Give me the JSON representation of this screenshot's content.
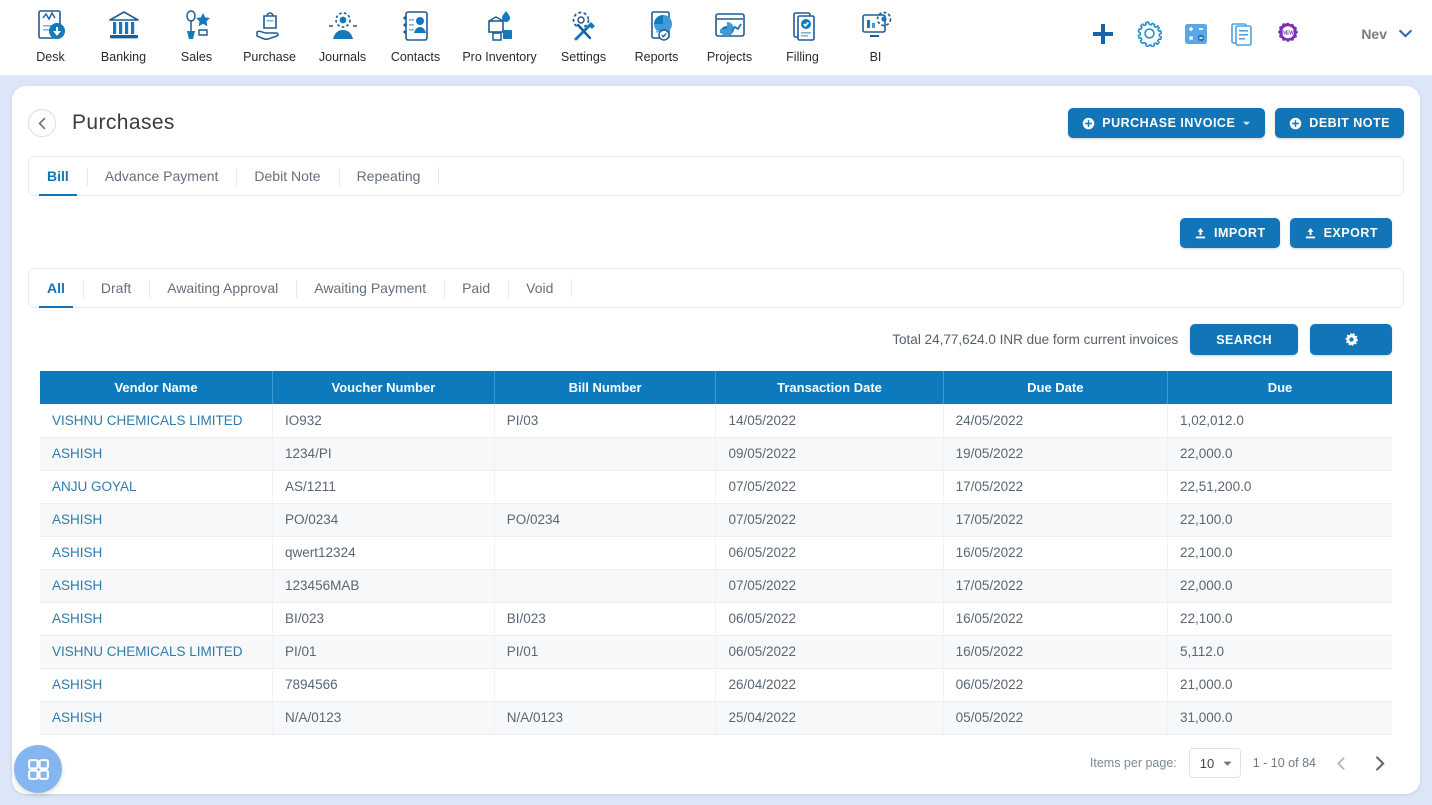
{
  "topnav": {
    "items": [
      {
        "label": "Desk",
        "icon": "desk-icon"
      },
      {
        "label": "Banking",
        "icon": "bank-icon"
      },
      {
        "label": "Sales",
        "icon": "sales-icon"
      },
      {
        "label": "Purchase",
        "icon": "purchase-icon"
      },
      {
        "label": "Journals",
        "icon": "journals-icon"
      },
      {
        "label": "Contacts",
        "icon": "contacts-icon"
      },
      {
        "label": "Pro Inventory",
        "icon": "inventory-icon"
      },
      {
        "label": "Settings",
        "icon": "settings-icon"
      },
      {
        "label": "Reports",
        "icon": "reports-icon"
      },
      {
        "label": "Projects",
        "icon": "projects-icon"
      },
      {
        "label": "Filling",
        "icon": "filling-icon"
      },
      {
        "label": "BI",
        "icon": "bi-icon"
      }
    ],
    "actions": [
      {
        "name": "add-icon",
        "title": "Add"
      },
      {
        "name": "gear-icon",
        "title": "Settings"
      },
      {
        "name": "calculator-icon",
        "title": "Calculator"
      },
      {
        "name": "document-icon",
        "title": "Documents"
      },
      {
        "name": "new-badge-icon",
        "title": "New"
      }
    ],
    "user": {
      "name": "Nev"
    }
  },
  "page": {
    "title": "Purchases",
    "back_label": "Back"
  },
  "header_buttons": {
    "purchase_invoice": "PURCHASE INVOICE",
    "debit_note": "DEBIT NOTE"
  },
  "doc_tabs": [
    {
      "label": "Bill",
      "active": true
    },
    {
      "label": "Advance Payment",
      "active": false
    },
    {
      "label": "Debit Note",
      "active": false
    },
    {
      "label": "Repeating",
      "active": false
    }
  ],
  "io_buttons": {
    "import": "IMPORT",
    "export": "EXPORT"
  },
  "status_tabs": [
    {
      "label": "All",
      "active": true
    },
    {
      "label": "Draft",
      "active": false
    },
    {
      "label": "Awaiting Approval",
      "active": false
    },
    {
      "label": "Awaiting Payment",
      "active": false
    },
    {
      "label": "Paid",
      "active": false
    },
    {
      "label": "Void",
      "active": false
    }
  ],
  "search_row": {
    "total_text": "Total 24,77,624.0 INR due form current invoices",
    "search_label": "SEARCH",
    "settings_icon": "gear-icon"
  },
  "table": {
    "columns": [
      "Vendor Name",
      "Voucher Number",
      "Bill Number",
      "Transaction Date",
      "Due Date",
      "Due"
    ],
    "rows": [
      {
        "vendor": "VISHNU CHEMICALS LIMITED",
        "voucher": "IO932",
        "bill": "PI/03",
        "txn_date": "14/05/2022",
        "due_date": "24/05/2022",
        "due": "1,02,012.0"
      },
      {
        "vendor": "ASHISH",
        "voucher": "1234/PI",
        "bill": "",
        "txn_date": "09/05/2022",
        "due_date": "19/05/2022",
        "due": "22,000.0"
      },
      {
        "vendor": "ANJU GOYAL",
        "voucher": "AS/1211",
        "bill": "",
        "txn_date": "07/05/2022",
        "due_date": "17/05/2022",
        "due": "22,51,200.0"
      },
      {
        "vendor": "ASHISH",
        "voucher": "PO/0234",
        "bill": "PO/0234",
        "txn_date": "07/05/2022",
        "due_date": "17/05/2022",
        "due": "22,100.0"
      },
      {
        "vendor": "ASHISH",
        "voucher": "qwert12324",
        "bill": "",
        "txn_date": "06/05/2022",
        "due_date": "16/05/2022",
        "due": "22,100.0"
      },
      {
        "vendor": "ASHISH",
        "voucher": "123456MAB",
        "bill": "",
        "txn_date": "07/05/2022",
        "due_date": "17/05/2022",
        "due": "22,000.0"
      },
      {
        "vendor": "ASHISH",
        "voucher": "BI/023",
        "bill": "BI/023",
        "txn_date": "06/05/2022",
        "due_date": "16/05/2022",
        "due": "22,100.0"
      },
      {
        "vendor": "VISHNU CHEMICALS LIMITED",
        "voucher": "PI/01",
        "bill": "PI/01",
        "txn_date": "06/05/2022",
        "due_date": "16/05/2022",
        "due": "5,112.0"
      },
      {
        "vendor": "ASHISH",
        "voucher": "7894566",
        "bill": "",
        "txn_date": "26/04/2022",
        "due_date": "06/05/2022",
        "due": "21,000.0"
      },
      {
        "vendor": "ASHISH",
        "voucher": "N/A/0123",
        "bill": "N/A/0123",
        "txn_date": "25/04/2022",
        "due_date": "05/05/2022",
        "due": "31,000.0"
      }
    ]
  },
  "pagination": {
    "items_per_page_label": "Items per page:",
    "items_per_page_value": "10",
    "range": "1 - 10 of 84"
  },
  "fab": {
    "icon": "grid-apps-icon"
  },
  "colors": {
    "primary": "#1275b8",
    "table_header": "#0d7abe",
    "page_bg": "#dce6f8",
    "link": "#2f7bab",
    "fab": "#86b6f0"
  }
}
